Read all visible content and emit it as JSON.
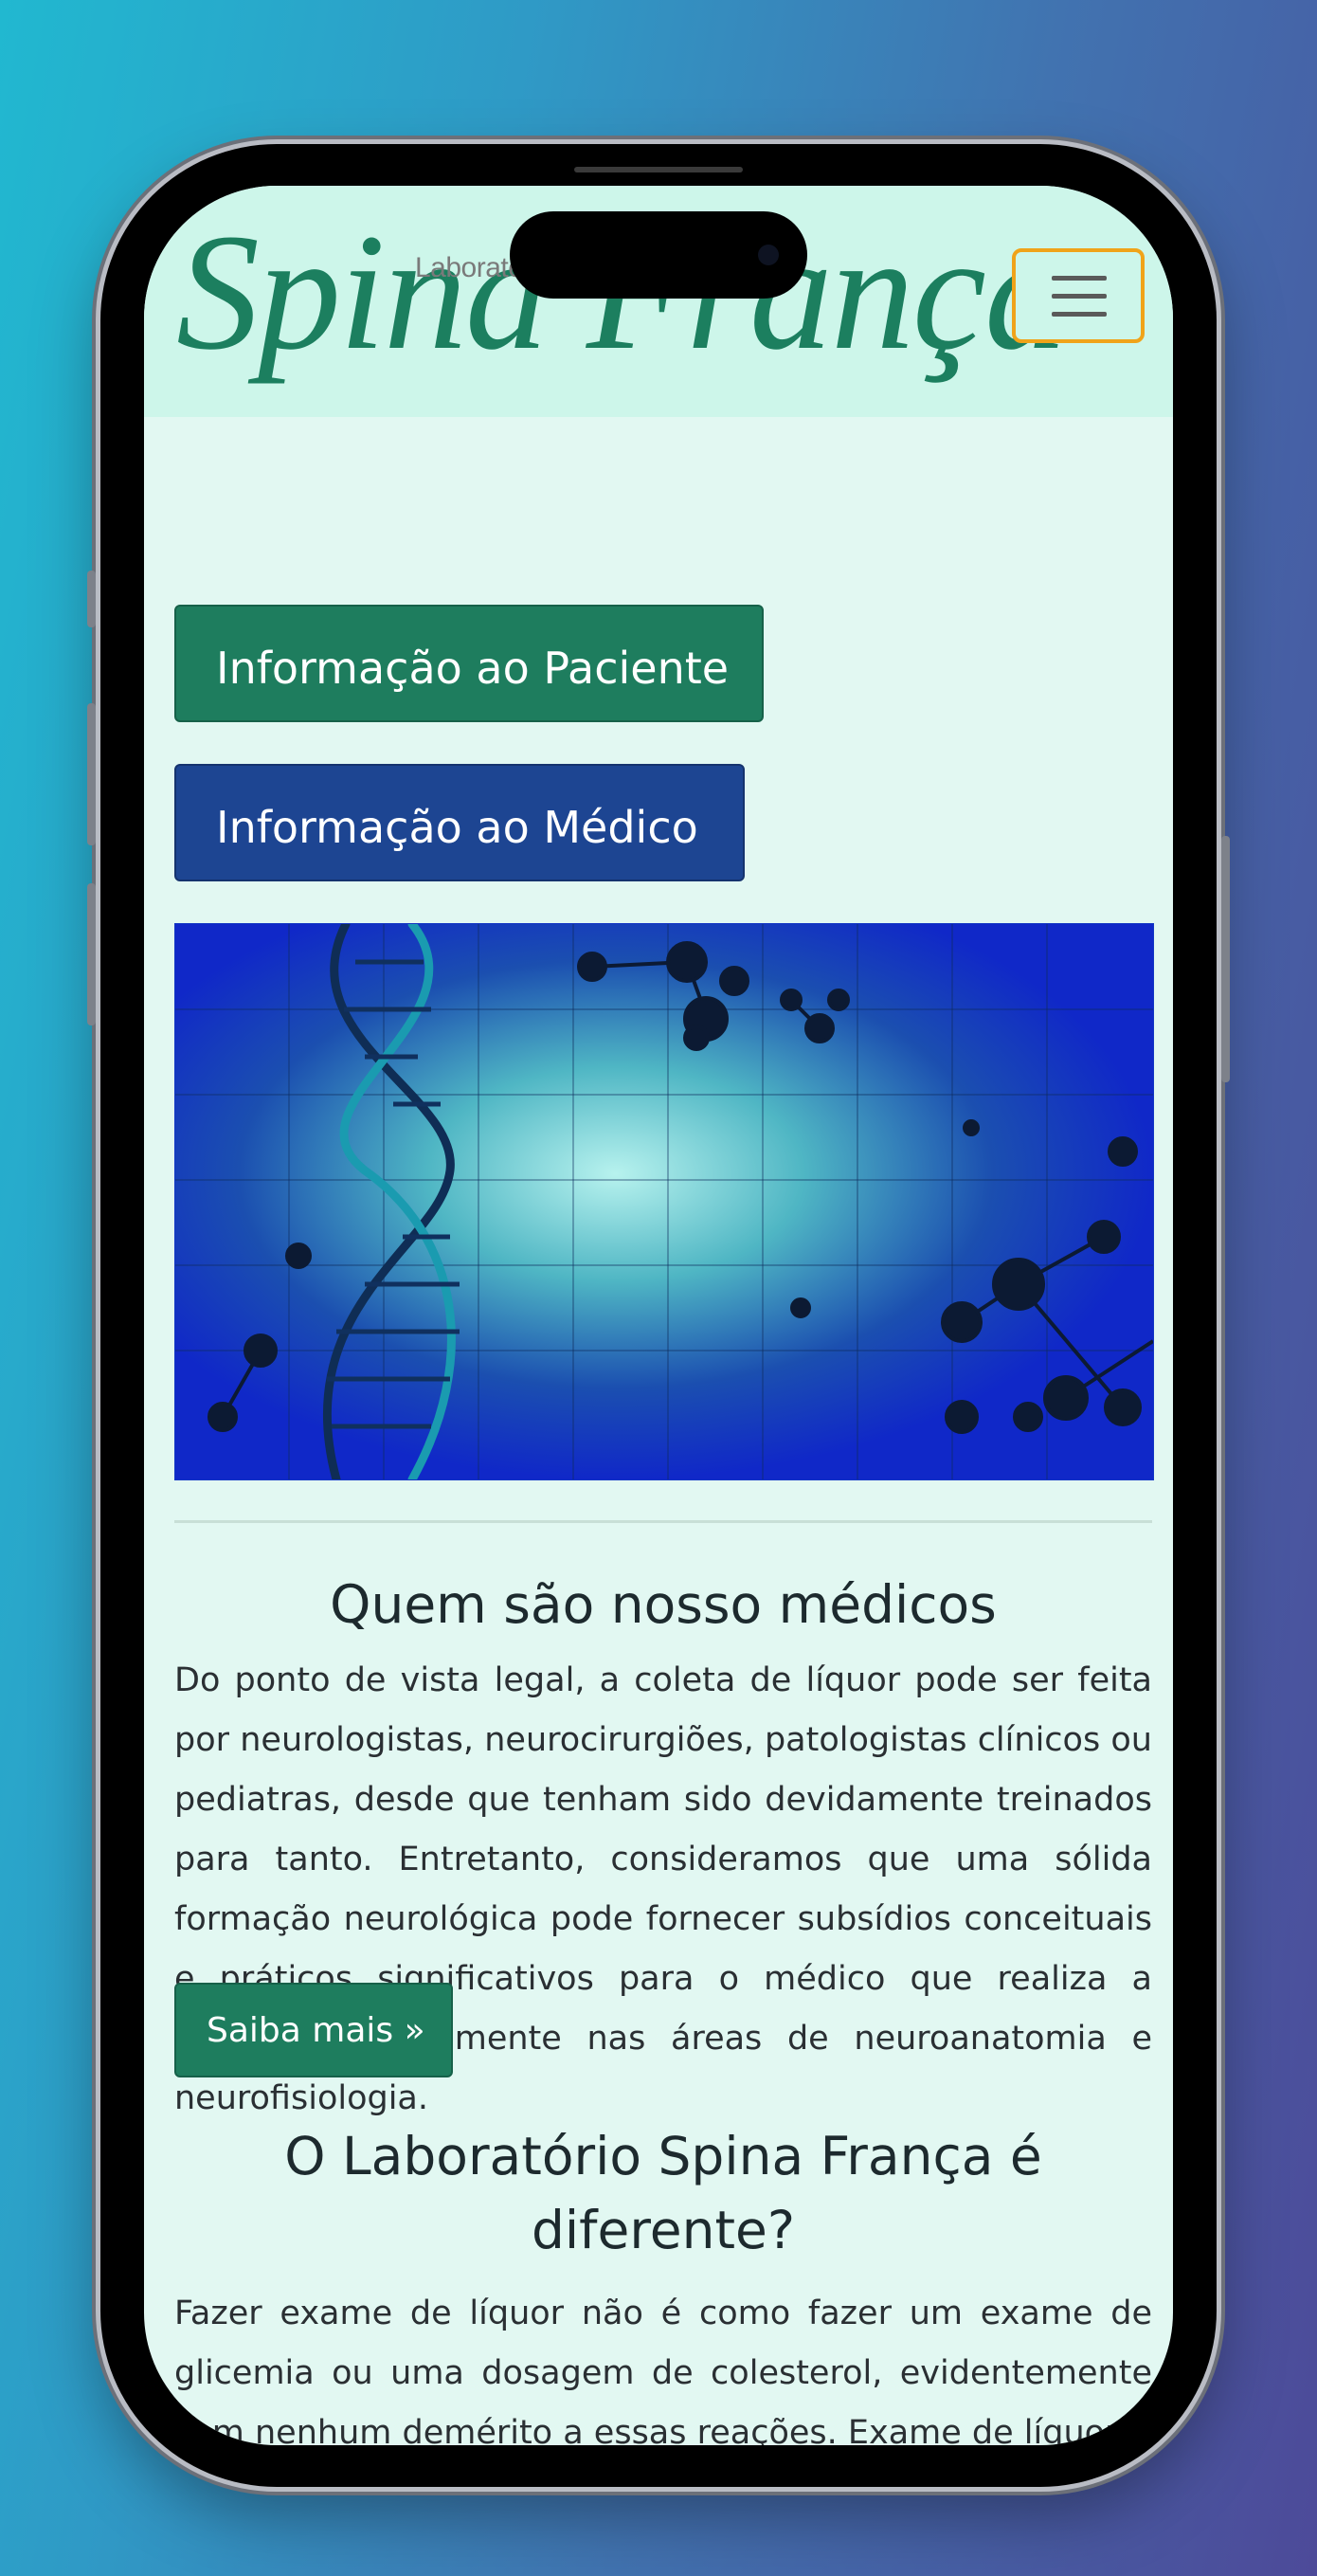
{
  "header": {
    "logo_small": "Laboratório",
    "logo_script": "Spina França",
    "menu_toggle": "menu"
  },
  "nav_buttons": {
    "patient": "Informação ao Paciente",
    "doctor": "Informação ao Médico"
  },
  "section1": {
    "title": "Quem são nosso médicos",
    "body": "Do ponto de vista legal, a coleta de líquor pode ser feita por neurologistas, neurocirurgiões, patologistas clínicos ou pediatras, desde que tenham sido devidamente treinados para tanto. Entretanto, consideramos que uma sólida formação neurológica pode fornecer subsídios conceituais e práticos significativos para o médico que realiza a coleta, principalmente nas áreas de neuroanatomia e neurofisiologia.",
    "more_button": "Saiba mais »"
  },
  "section2": {
    "title": "O Laboratório Spina França é diferente?",
    "body": "Fazer exame de líquor não é como fazer um exame de glicemia ou uma dosagem de colesterol, evidentemente sem nenhum demérito a essas reações. Exame de líquor"
  },
  "colors": {
    "header_bg": "#cdf6ea",
    "page_bg": "#e2f8f2",
    "brand_green": "#1e7d5e",
    "brand_blue": "#1d4592",
    "toggle_border": "#f0a319"
  },
  "icons": {
    "menu": "hamburger-icon"
  }
}
